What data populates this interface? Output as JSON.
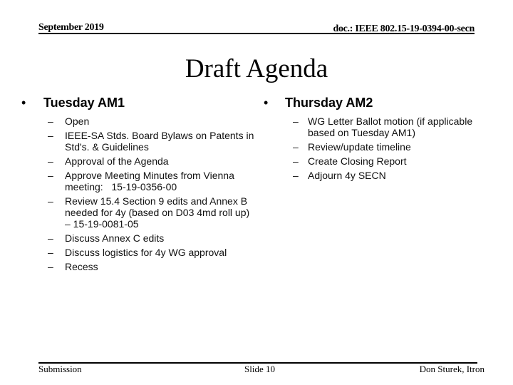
{
  "header": {
    "date": "September 2019",
    "doc_id": "doc.: IEEE 802.15-19-0394-00-secn"
  },
  "title": "Draft Agenda",
  "bullet_glyph": "•",
  "dash_glyph": "–",
  "left_column": {
    "heading": "Tuesday AM1",
    "items": [
      "Open",
      "IEEE-SA Stds. Board Bylaws on Patents in Std's. & Guidelines",
      "Approval of the Agenda",
      "Approve Meeting Minutes from Vienna meeting:   15-19-0356-00",
      "Review 15.4 Section 9 edits and Annex B needed for 4y (based on D03 4md roll up) – 15-19-0081-05",
      "Discuss Annex C edits",
      "Discuss logistics for 4y WG approval",
      "Recess"
    ]
  },
  "right_column": {
    "heading": "Thursday AM2",
    "items": [
      "WG Letter Ballot motion (if applicable based on Tuesday AM1)",
      "Review/update timeline",
      "Create Closing Report",
      "Adjourn 4y SECN"
    ]
  },
  "footer": {
    "left": "Submission",
    "center": "Slide 10",
    "right": "Don Sturek, Itron"
  }
}
